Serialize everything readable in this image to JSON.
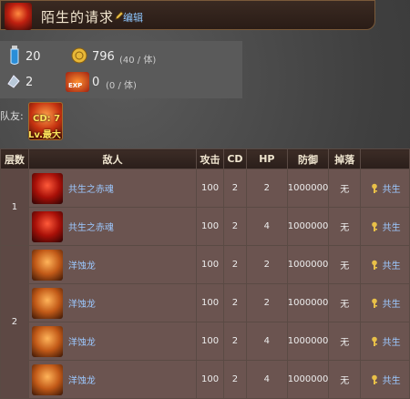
{
  "header": {
    "title": "陌生的请求",
    "edit_label": "编辑"
  },
  "stats": {
    "stamina": "20",
    "coins": "796",
    "coins_rate": "(40 / 体)",
    "crystals": "2",
    "exp_label": "EXP",
    "exp": "0",
    "exp_rate": "(0 / 体)"
  },
  "team": {
    "label": "队友:",
    "cd": "CD: 7",
    "lv": "Lv.最大"
  },
  "table": {
    "headers": [
      "层数",
      "敌人",
      "攻击",
      "CD",
      "HP",
      "防御",
      "掉落",
      ""
    ],
    "floors": [
      {
        "label": "1"
      },
      {
        "label": "2"
      }
    ],
    "rows": [
      {
        "enemy": "共生之赤魂",
        "attack": "100",
        "cd": "2",
        "hp": "2",
        "defense": "1000000",
        "drop": "无",
        "reward": "共生"
      },
      {
        "enemy": "共生之赤魂",
        "attack": "100",
        "cd": "2",
        "hp": "4",
        "defense": "1000000",
        "drop": "无",
        "reward": "共生"
      },
      {
        "enemy": "洋蚀龙",
        "attack": "100",
        "cd": "2",
        "hp": "2",
        "defense": "1000000",
        "drop": "无",
        "reward": "共生"
      },
      {
        "enemy": "洋蚀龙",
        "attack": "100",
        "cd": "2",
        "hp": "2",
        "defense": "1000000",
        "drop": "无",
        "reward": "共生"
      },
      {
        "enemy": "洋蚀龙",
        "attack": "100",
        "cd": "2",
        "hp": "4",
        "defense": "1000000",
        "drop": "无",
        "reward": "共生"
      },
      {
        "enemy": "洋蚀龙",
        "attack": "100",
        "cd": "2",
        "hp": "4",
        "defense": "1000000",
        "drop": "无",
        "reward": "共生"
      }
    ]
  }
}
